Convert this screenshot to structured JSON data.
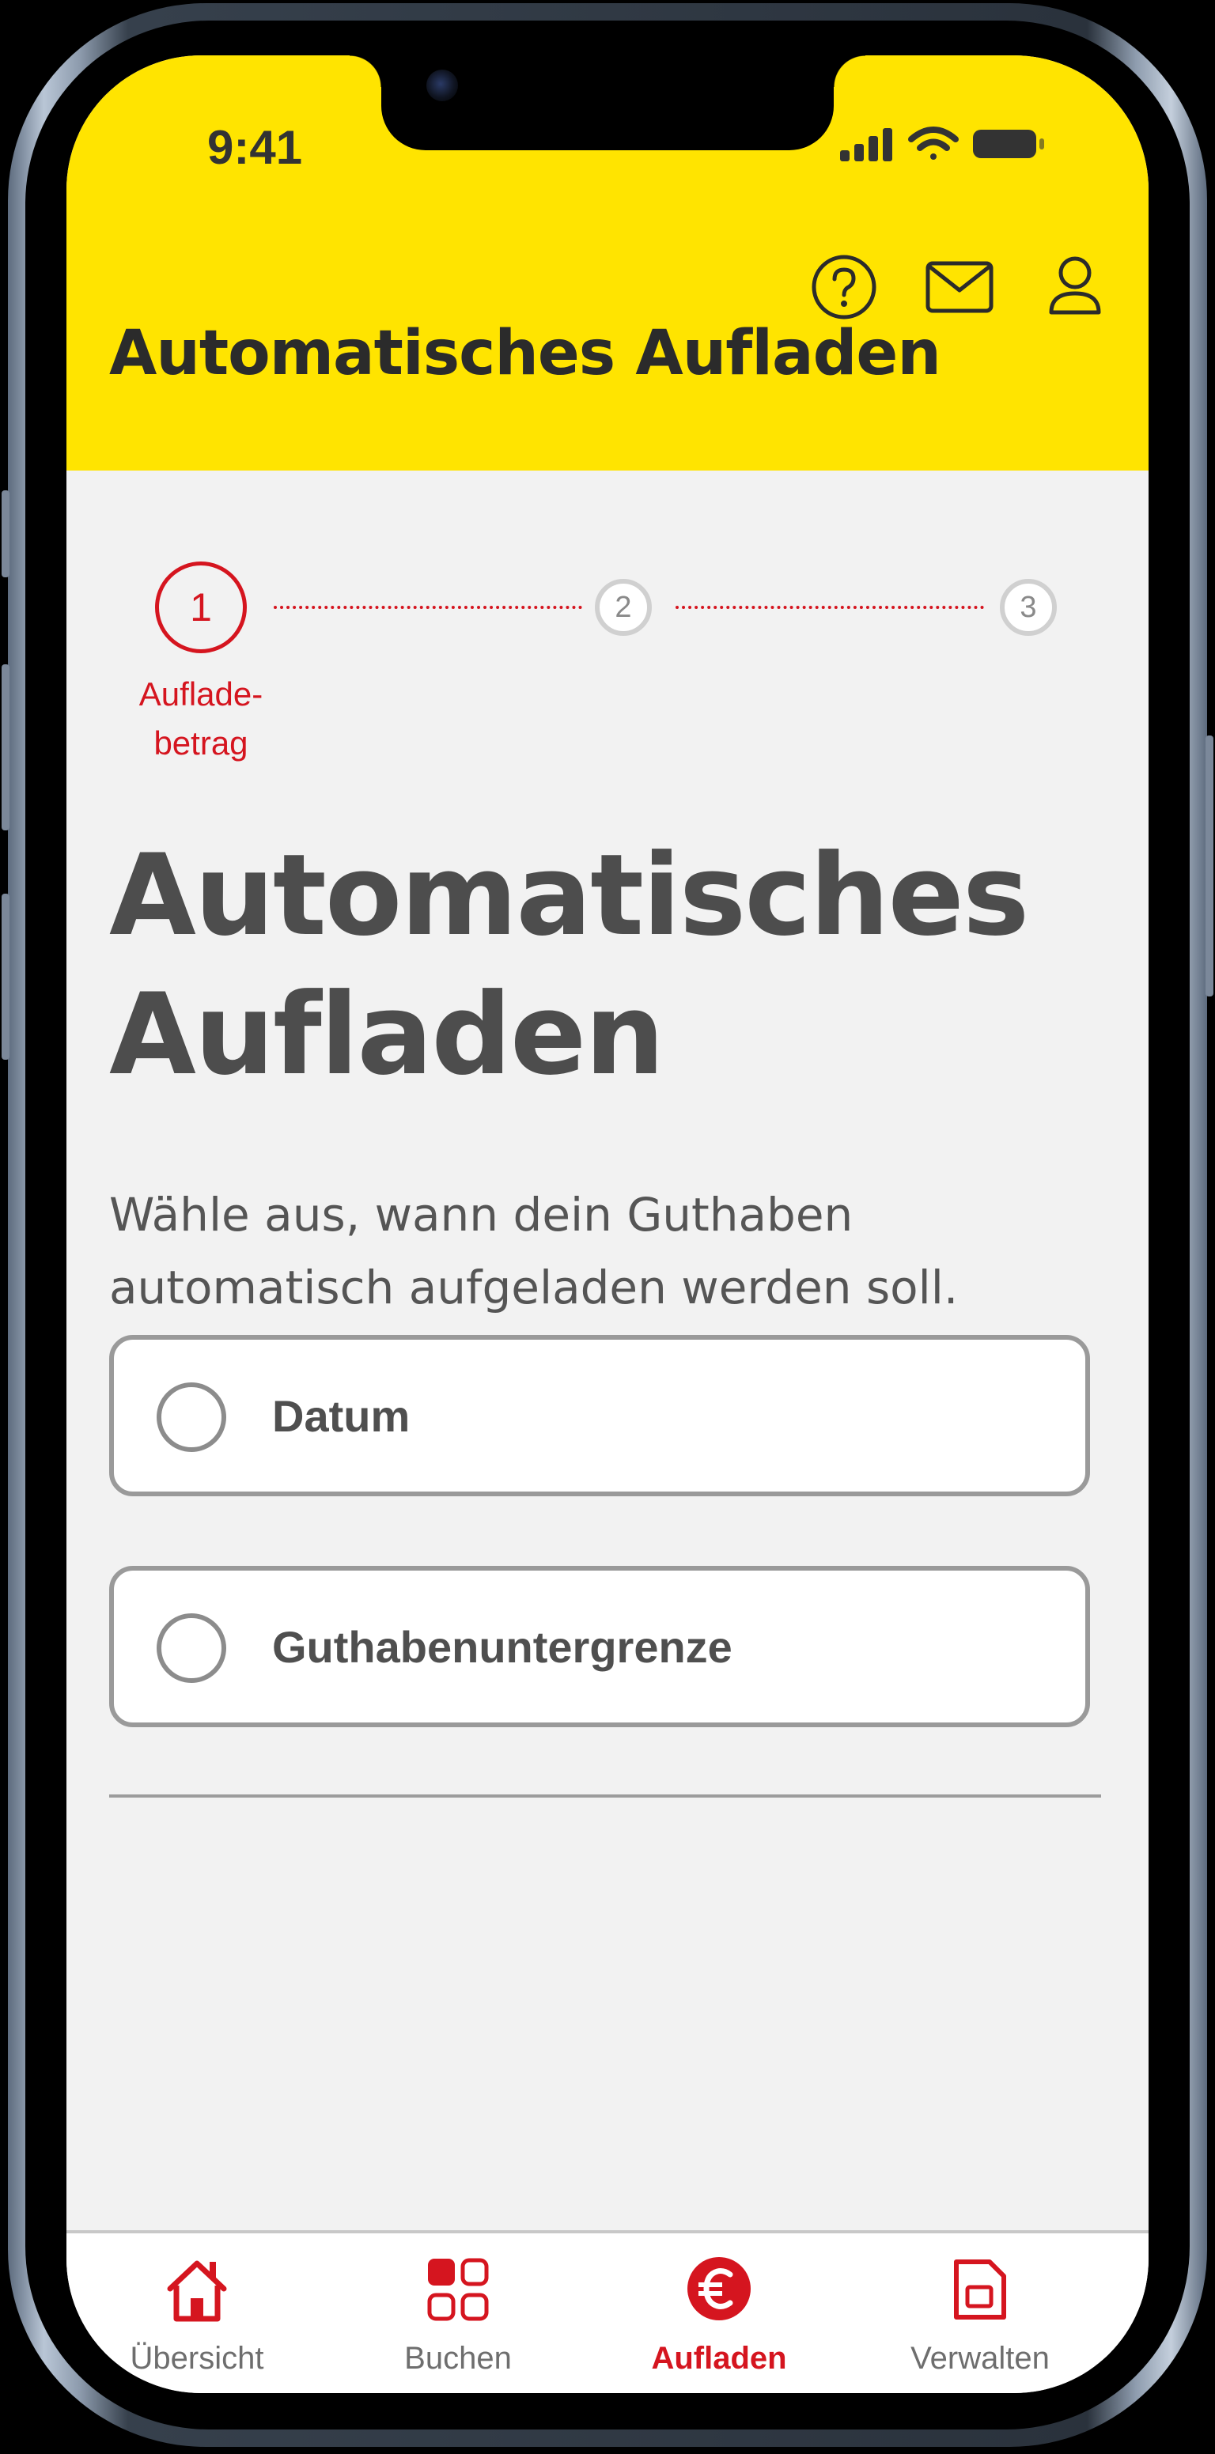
{
  "status_bar": {
    "time": "9:41"
  },
  "header": {
    "title": "Automatisches Aufladen"
  },
  "stepper": {
    "steps": [
      {
        "number": "1",
        "label": "Auflade-betrag",
        "label_line1": "Auflade-",
        "label_line2": "betrag",
        "state": "active"
      },
      {
        "number": "2",
        "state": "inactive"
      },
      {
        "number": "3",
        "state": "inactive"
      }
    ]
  },
  "main": {
    "title_line1": "Automatisches",
    "title_line2": "Aufladen",
    "description_line1": "Wähle aus, wann dein Guthaben",
    "description_line2": "automatisch aufgeladen werden soll.",
    "options": [
      {
        "label": "Datum",
        "selected": false
      },
      {
        "label": "Guthabenuntergrenze",
        "selected": false
      }
    ]
  },
  "bottom_nav": {
    "items": [
      {
        "label": "Übersicht",
        "icon": "home-icon",
        "active": false
      },
      {
        "label": "Buchen",
        "icon": "grid-icon",
        "active": false
      },
      {
        "label": "Aufladen",
        "icon": "euro-icon",
        "active": true
      },
      {
        "label": "Verwalten",
        "icon": "sim-card-icon",
        "active": false
      }
    ]
  },
  "colors": {
    "brand_yellow": "#ffe400",
    "accent_red": "#d5151f",
    "text_dark": "#4d4d4d"
  }
}
